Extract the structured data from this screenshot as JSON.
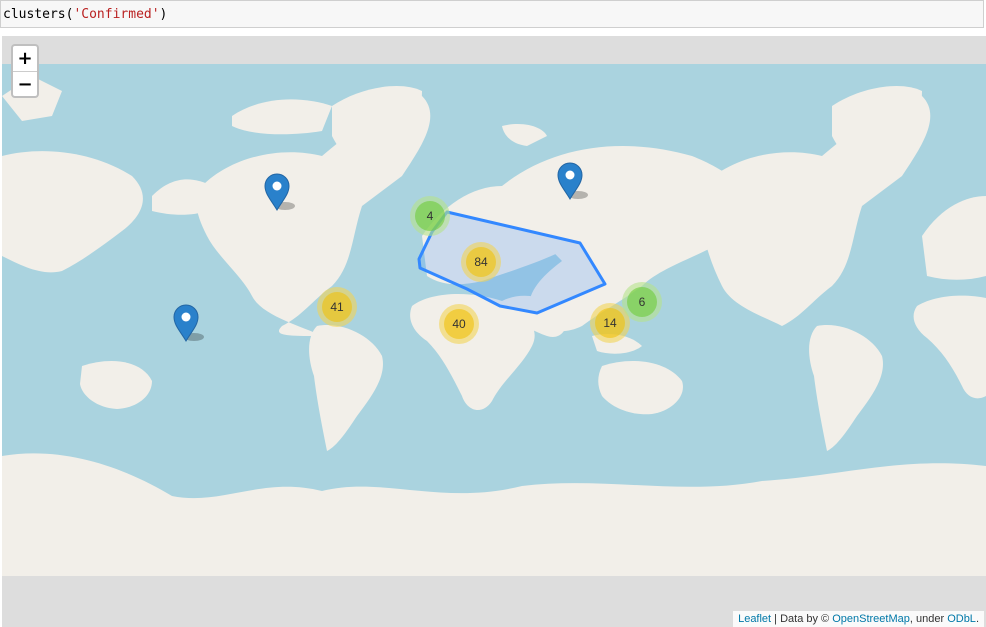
{
  "code": {
    "func": "clusters(",
    "arg": "'Confirmed'",
    "close": ")"
  },
  "map": {
    "zoom_in_label": "+",
    "zoom_out_label": "−",
    "attribution": {
      "leaflet": "Leaflet",
      "sep1": " | Data by © ",
      "osm": "OpenStreetMap",
      "sep2": ", under ",
      "odbl": "ODbL",
      "end": "."
    },
    "clusters": [
      {
        "count": "4",
        "level": "small",
        "region": "Western Europe"
      },
      {
        "count": "84",
        "level": "medium",
        "region": "Middle East"
      },
      {
        "count": "41",
        "level": "medium",
        "region": "South America north"
      },
      {
        "count": "40",
        "level": "medium",
        "region": "Central Africa"
      },
      {
        "count": "14",
        "level": "medium",
        "region": "Southeast Asia"
      },
      {
        "count": "6",
        "level": "small",
        "region": "Philippines"
      }
    ],
    "markers": [
      {
        "name": "canada-marker",
        "region": "Canada"
      },
      {
        "name": "russia-marker",
        "region": "Russia"
      },
      {
        "name": "pacific-marker",
        "region": "Pacific Ocean"
      }
    ],
    "colors": {
      "ocean": "#aad3df",
      "land": "#f2efe9",
      "cluster_small": "#6ecc39",
      "cluster_small_halo": "#b5e28c",
      "cluster_medium": "#f0c20c",
      "cluster_medium_halo": "#f1d357",
      "polygon": "#3388ff",
      "marker": "#2a81cb"
    }
  }
}
